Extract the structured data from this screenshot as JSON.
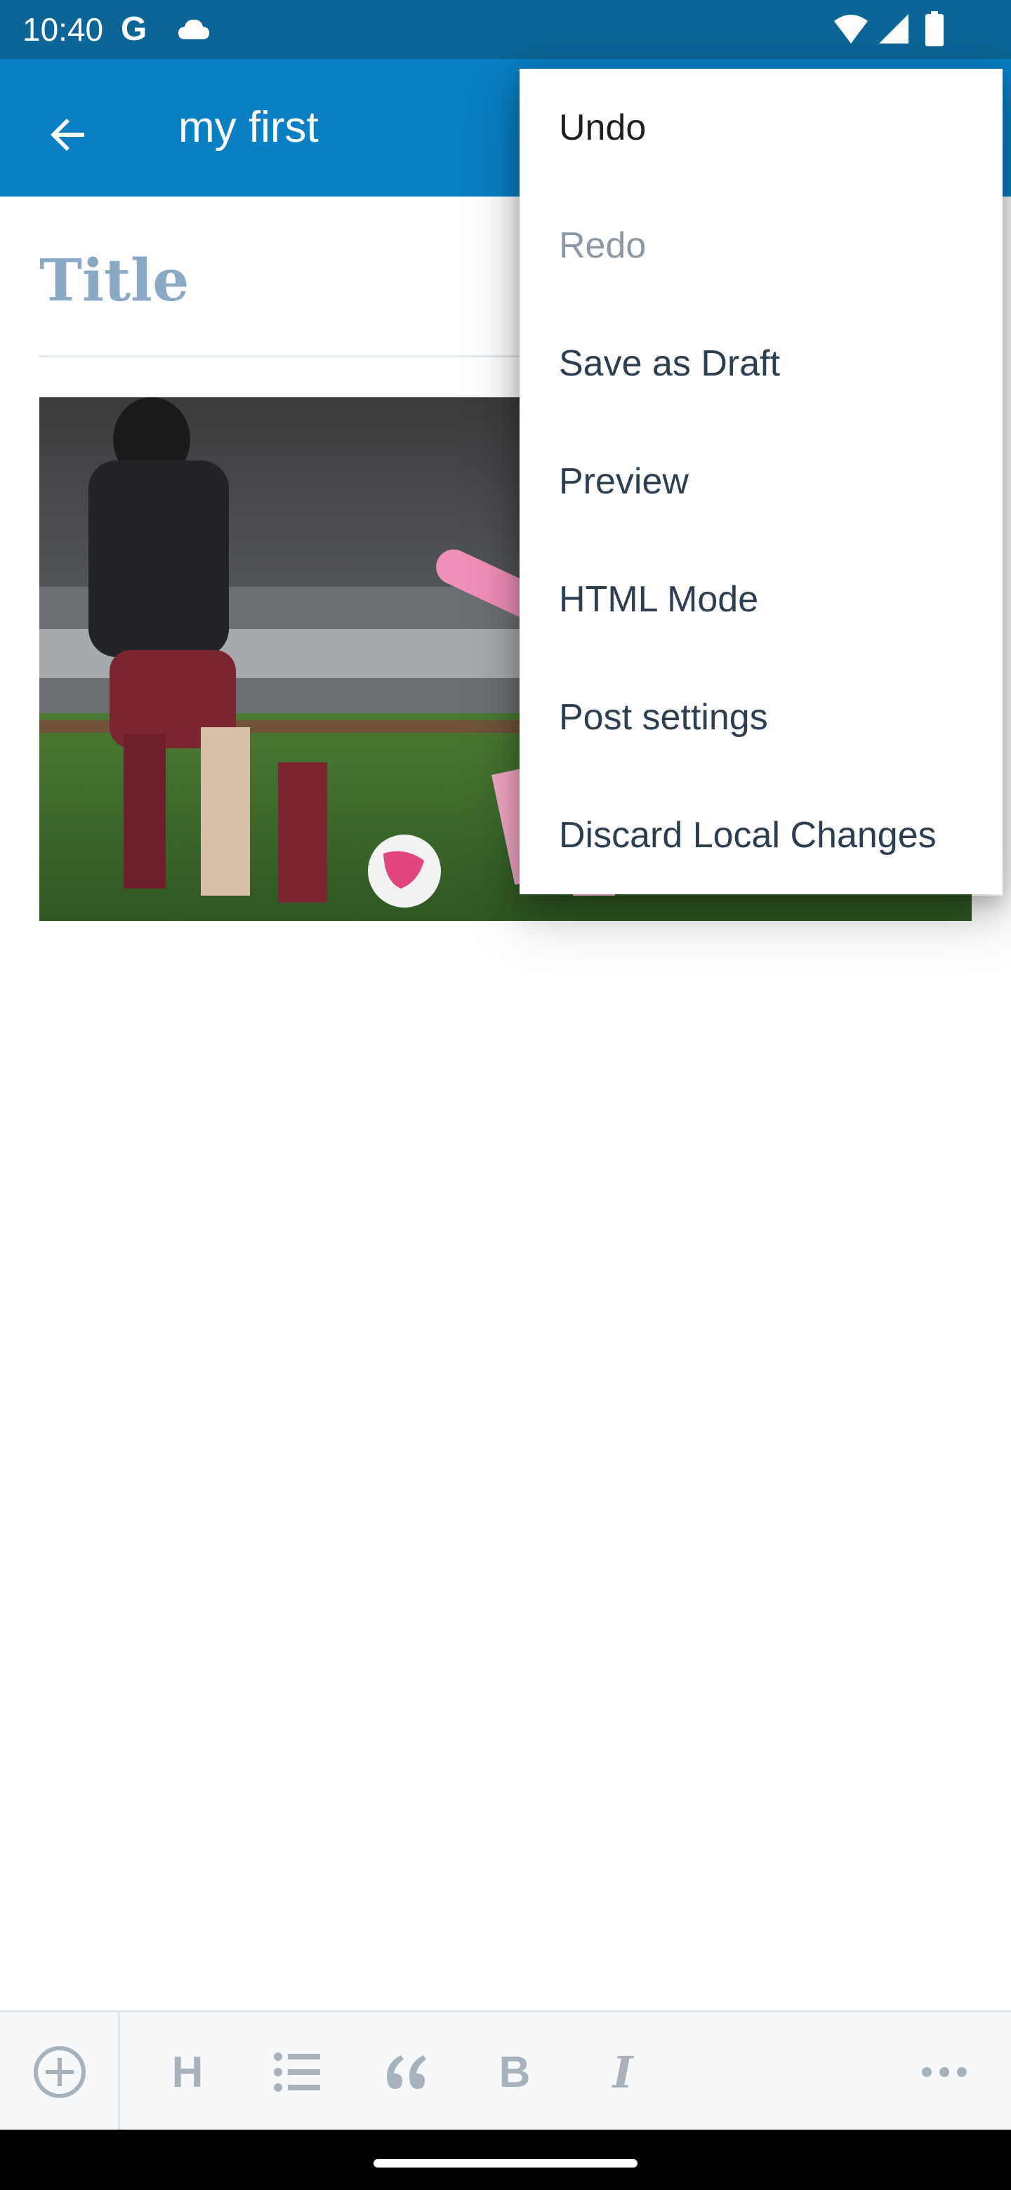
{
  "status_bar": {
    "time": "10:40",
    "g_label": "G",
    "icons": [
      "cloud-icon",
      "wifi-icon",
      "signal-icon",
      "battery-icon"
    ]
  },
  "app_bar": {
    "back_icon": "arrow-left-icon",
    "title": "my first"
  },
  "editor": {
    "title_placeholder": "Title",
    "image": "soccer-match-photo"
  },
  "overflow_menu": {
    "items": [
      {
        "label": "Undo",
        "enabled": true
      },
      {
        "label": "Redo",
        "enabled": false
      },
      {
        "label": "Save as Draft",
        "enabled": true
      },
      {
        "label": "Preview",
        "enabled": true
      },
      {
        "label": "HTML Mode",
        "enabled": true
      },
      {
        "label": "Post settings",
        "enabled": true
      },
      {
        "label": "Discard Local Changes",
        "enabled": true
      }
    ]
  },
  "format_toolbar": {
    "heading_label": "H",
    "bold_label": "B",
    "italic_label": "I",
    "icons": [
      "add-block-icon",
      "heading-icon",
      "list-icon",
      "quote-icon",
      "bold-icon",
      "italic-icon",
      "more-icon"
    ]
  },
  "colors": {
    "status_bar": "#0b6596",
    "app_bar": "#0a7fc4",
    "title_placeholder": "#8aa9c4",
    "menu_text": "#2c3e50",
    "menu_disabled": "#8c98a3"
  }
}
